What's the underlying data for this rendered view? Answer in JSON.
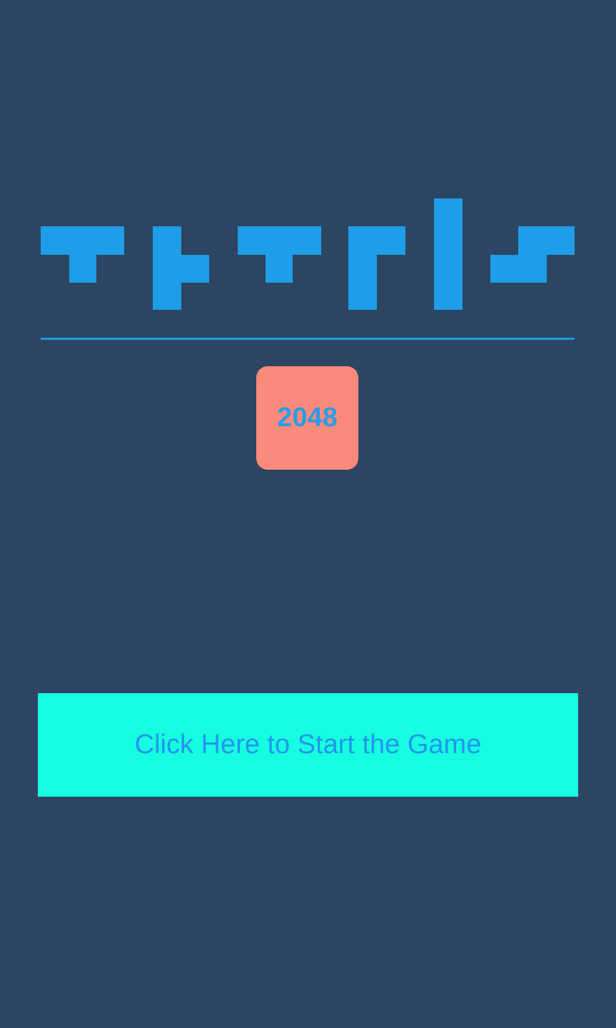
{
  "theme": {
    "background": "#2c4562",
    "logo_color": "#1e9de8",
    "divider_color": "#1e9de8"
  },
  "logo": {
    "icon": "tetris-block-logo"
  },
  "tile": {
    "label": "2048",
    "background": "#fa8a7b",
    "text_color": "#2c9be6"
  },
  "start_button": {
    "label": "Click Here to Start the Game",
    "background": "#17fde1",
    "text_color": "#2196ec"
  }
}
